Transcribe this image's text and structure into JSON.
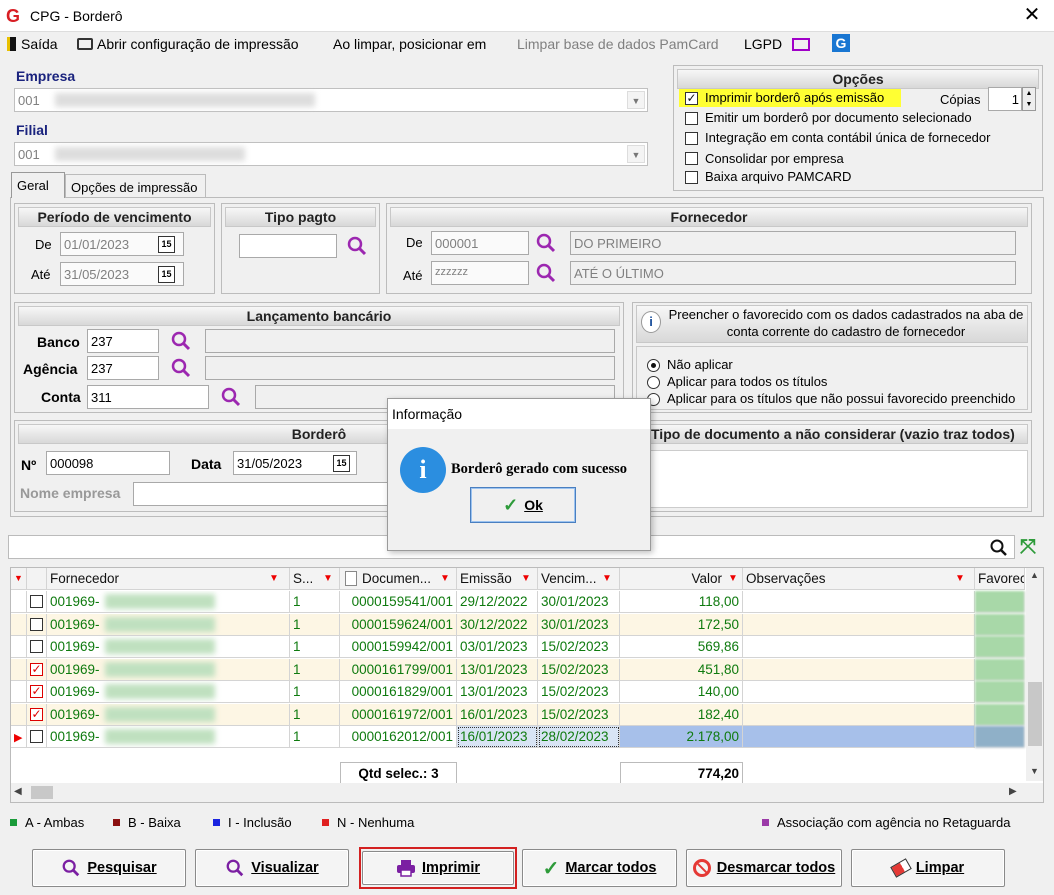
{
  "window": {
    "title": "CPG - Borderô",
    "close": "✕"
  },
  "menu": {
    "exit": "Saída",
    "print_config": "Abrir configuração de impressão",
    "on_clear": "Ao limpar, posicionar em",
    "clear_pamcard": "Limpar base de dados PamCard",
    "lgpd": "LGPD"
  },
  "empresa": {
    "label": "Empresa",
    "value": "001"
  },
  "filial": {
    "label": "Filial",
    "value": "001"
  },
  "opcoes": {
    "title": "Opções",
    "copias_label": "Cópias",
    "copias_value": "1",
    "items": [
      {
        "label": "Imprimir borderô após emissão",
        "checked": true
      },
      {
        "label": "Emitir um borderô por documento selecionado",
        "checked": false
      },
      {
        "label": "Integração em conta contábil única de fornecedor",
        "checked": false
      },
      {
        "label": "Consolidar por empresa",
        "checked": false
      },
      {
        "label": "Baixa arquivo PAMCARD",
        "checked": false
      }
    ]
  },
  "tabs": [
    "Geral",
    "Opções de impressão"
  ],
  "periodo": {
    "title": "Período de vencimento",
    "de_label": "De",
    "de_value": "01/01/2023",
    "ate_label": "Até",
    "ate_value": "31/05/2023",
    "cal": "15"
  },
  "tipo_pagto": {
    "title": "Tipo pagto",
    "value": ""
  },
  "fornecedor": {
    "title": "Fornecedor",
    "de_label": "De",
    "de_code": "000001",
    "de_name": "DO PRIMEIRO",
    "ate_label": "Até",
    "ate_code": "zzzzzz",
    "ate_name": "ATÉ O ÚLTIMO"
  },
  "lancamento": {
    "title": "Lançamento bancário",
    "banco_label": "Banco",
    "banco_value": "237",
    "agencia_label": "Agência",
    "agencia_value": "237",
    "conta_label": "Conta",
    "conta_value": "311"
  },
  "favorecido": {
    "header": "Preencher o favorecido com os dados cadastrados na aba de conta corrente do cadastro de fornecedor",
    "options": [
      "Não aplicar",
      "Aplicar para todos os títulos",
      "Aplicar para os títulos que não possui favorecido preenchido"
    ],
    "selected": 0
  },
  "bordero": {
    "title": "Borderô",
    "num_label": "Nº",
    "num_value": "000098",
    "data_label": "Data",
    "data_value": "31/05/2023",
    "nome_label": "Nome empresa",
    "nome_value": ""
  },
  "tipo_doc": {
    "title": "Tipo de documento a não considerar (vazio traz todos)"
  },
  "grid": {
    "columns": [
      "Fornecedor",
      "S...",
      "Documen...",
      "Emissão",
      "Vencim...",
      "Valor",
      "Observações",
      "Favorec"
    ],
    "rows": [
      {
        "checked": false,
        "fornecedor": "001969-",
        "s": "1",
        "documento": "0000159541/001",
        "emissao": "29/12/2022",
        "vencimento": "30/01/2023",
        "valor": "118,00"
      },
      {
        "checked": false,
        "fornecedor": "001969-",
        "s": "1",
        "documento": "0000159624/001",
        "emissao": "30/12/2022",
        "vencimento": "30/01/2023",
        "valor": "172,50"
      },
      {
        "checked": false,
        "fornecedor": "001969-",
        "s": "1",
        "documento": "0000159942/001",
        "emissao": "03/01/2023",
        "vencimento": "15/02/2023",
        "valor": "569,86"
      },
      {
        "checked": true,
        "fornecedor": "001969-",
        "s": "1",
        "documento": "0000161799/001",
        "emissao": "13/01/2023",
        "vencimento": "15/02/2023",
        "valor": "451,80"
      },
      {
        "checked": true,
        "fornecedor": "001969-",
        "s": "1",
        "documento": "0000161829/001",
        "emissao": "13/01/2023",
        "vencimento": "15/02/2023",
        "valor": "140,00"
      },
      {
        "checked": true,
        "fornecedor": "001969-",
        "s": "1",
        "documento": "0000161972/001",
        "emissao": "16/01/2023",
        "vencimento": "15/02/2023",
        "valor": "182,40"
      },
      {
        "checked": false,
        "fornecedor": "001969-",
        "s": "1",
        "documento": "0000162012/001",
        "emissao": "16/01/2023",
        "vencimento": "28/02/2023",
        "valor": "2.178,00"
      }
    ],
    "footer_label": "Qtd selec.: 3",
    "footer_total": "774,20"
  },
  "legend": [
    {
      "label": "A - Ambas",
      "color": "#1a9b3a"
    },
    {
      "label": "B - Baixa",
      "color": "#8b1010"
    },
    {
      "label": "I - Inclusão",
      "color": "#1a24e0"
    },
    {
      "label": "N - Nenhuma",
      "color": "#e02020"
    },
    {
      "label": "Associação com agência no Retaguarda",
      "color": "#9b3aa8"
    }
  ],
  "buttons": {
    "pesquisar": "Pesquisar",
    "visualizar": "Visualizar",
    "imprimir": "Imprimir",
    "marcar": "Marcar todos",
    "desmarcar": "Desmarcar todos",
    "limpar": "Limpar"
  },
  "dialog": {
    "title": "Informação",
    "message": "Borderô gerado com sucesso",
    "ok": "Ok"
  }
}
